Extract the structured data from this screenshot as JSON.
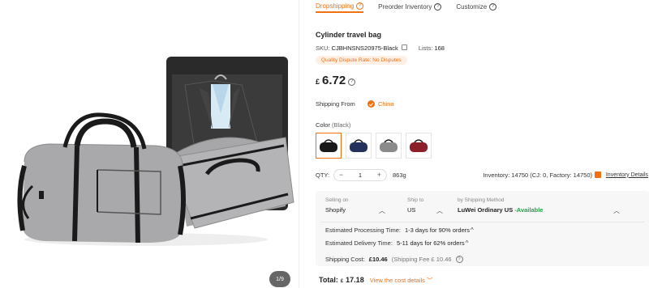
{
  "gallery": {
    "pager": "1/9"
  },
  "tabs": [
    {
      "label": "Dropshipping",
      "active": true
    },
    {
      "label": "Preorder Inventory",
      "active": false
    },
    {
      "label": "Customize",
      "active": false
    }
  ],
  "product": {
    "title": "Cylinder travel bag",
    "sku_label": "SKU:",
    "sku": "CJBHNSNS20975-Black",
    "lists_label": "Lists:",
    "lists": "168",
    "dispute": "Quality Dispute Rate: No Disputes",
    "currency": "£",
    "price": "6.72"
  },
  "shipping_from": {
    "label": "Shipping From",
    "value": "China"
  },
  "color": {
    "label": "Color",
    "selected": "(Black)",
    "options": [
      "black",
      "navy",
      "gray",
      "red"
    ],
    "colors": {
      "black": "#1a1a1a",
      "navy": "#23315c",
      "gray": "#8a8a8a",
      "red": "#8c1f2a"
    }
  },
  "qty": {
    "label": "QTY:",
    "minus": "−",
    "value": "1",
    "plus": "+",
    "weight": "863g",
    "inventory": "Inventory: 14750  (CJ: 0, Factory: 14750)",
    "details_link": "Inventory Details"
  },
  "ship_box": {
    "selling_on_label": "Selling on",
    "selling_on": "Shopify",
    "ship_to_label": "Ship to",
    "ship_to": "US",
    "method_label": "by Shipping Method",
    "method": "LuWei Ordinary US",
    "method_status": "-Available",
    "processing_label": "Estimated Processing Time:",
    "processing": "1-3 days for 90% orders",
    "delivery_label": "Estimated Delivery Time:",
    "delivery": "5-11 days for 62% orders",
    "cost_label": "Shipping Cost:",
    "cost": "£10.46",
    "fee": "(Shipping Fee £ 10.46"
  },
  "total": {
    "label": "Total:",
    "currency": "£",
    "value": "17.18",
    "link": "View the cost details"
  },
  "accent": "#f1700f"
}
